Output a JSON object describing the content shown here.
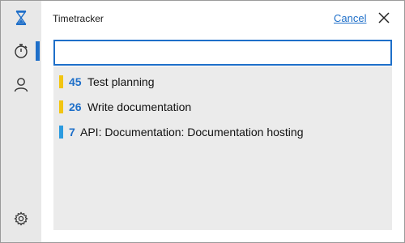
{
  "app": {
    "title": "Timetracker"
  },
  "header": {
    "cancel_label": "Cancel"
  },
  "search": {
    "value": "",
    "placeholder": ""
  },
  "sidebar": {
    "items": [
      {
        "icon": "hourglass-icon"
      },
      {
        "icon": "stopwatch-icon",
        "active": true
      },
      {
        "icon": "user-icon"
      },
      {
        "icon": "gear-icon"
      }
    ]
  },
  "colors": {
    "accent": "#1e6fc9",
    "yellow_tag": "#f2c511",
    "blue_tag": "#2b9be0"
  },
  "results": [
    {
      "number": "45",
      "label": "Test planning",
      "color": "#f2c511"
    },
    {
      "number": "26",
      "label": "Write documentation",
      "color": "#f2c511"
    },
    {
      "number": "7",
      "label": "API: Documentation: Documentation hosting",
      "color": "#2b9be0"
    }
  ]
}
